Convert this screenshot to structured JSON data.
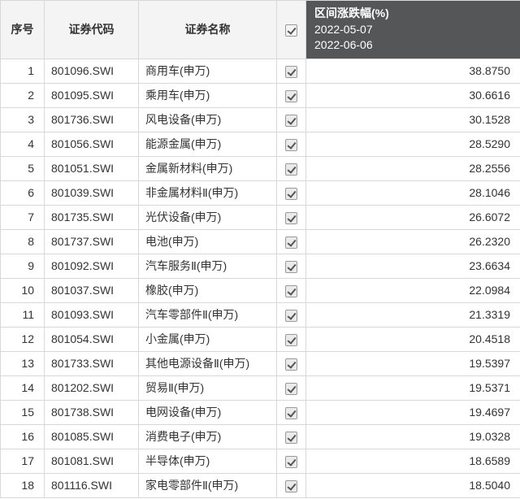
{
  "headers": {
    "index": "序号",
    "code": "证券代码",
    "name": "证券名称",
    "change_title": "区间涨跌幅(%)",
    "date_from": "2022-05-07",
    "date_to": "2022-06-06"
  },
  "rows": [
    {
      "idx": 1,
      "code": "801096.SWI",
      "name": "商用车(申万)",
      "checked": true,
      "val": "38.8750"
    },
    {
      "idx": 2,
      "code": "801095.SWI",
      "name": "乘用车(申万)",
      "checked": true,
      "val": "30.6616"
    },
    {
      "idx": 3,
      "code": "801736.SWI",
      "name": "风电设备(申万)",
      "checked": true,
      "val": "30.1528"
    },
    {
      "idx": 4,
      "code": "801056.SWI",
      "name": "能源金属(申万)",
      "checked": true,
      "val": "28.5290"
    },
    {
      "idx": 5,
      "code": "801051.SWI",
      "name": "金属新材料(申万)",
      "checked": true,
      "val": "28.2556"
    },
    {
      "idx": 6,
      "code": "801039.SWI",
      "name": "非金属材料Ⅱ(申万)",
      "checked": true,
      "val": "28.1046"
    },
    {
      "idx": 7,
      "code": "801735.SWI",
      "name": "光伏设备(申万)",
      "checked": true,
      "val": "26.6072"
    },
    {
      "idx": 8,
      "code": "801737.SWI",
      "name": "电池(申万)",
      "checked": true,
      "val": "26.2320"
    },
    {
      "idx": 9,
      "code": "801092.SWI",
      "name": "汽车服务Ⅱ(申万)",
      "checked": true,
      "val": "23.6634"
    },
    {
      "idx": 10,
      "code": "801037.SWI",
      "name": "橡胶(申万)",
      "checked": true,
      "val": "22.0984"
    },
    {
      "idx": 11,
      "code": "801093.SWI",
      "name": "汽车零部件Ⅱ(申万)",
      "checked": true,
      "val": "21.3319"
    },
    {
      "idx": 12,
      "code": "801054.SWI",
      "name": "小金属(申万)",
      "checked": true,
      "val": "20.4518"
    },
    {
      "idx": 13,
      "code": "801733.SWI",
      "name": "其他电源设备Ⅱ(申万)",
      "checked": true,
      "val": "19.5397"
    },
    {
      "idx": 14,
      "code": "801202.SWI",
      "name": "贸易Ⅱ(申万)",
      "checked": true,
      "val": "19.5371"
    },
    {
      "idx": 15,
      "code": "801738.SWI",
      "name": "电网设备(申万)",
      "checked": true,
      "val": "19.4697"
    },
    {
      "idx": 16,
      "code": "801085.SWI",
      "name": "消费电子(申万)",
      "checked": true,
      "val": "19.0328"
    },
    {
      "idx": 17,
      "code": "801081.SWI",
      "name": "半导体(申万)",
      "checked": true,
      "val": "18.6589"
    },
    {
      "idx": 18,
      "code": "801116.SWI",
      "name": "家电零部件Ⅱ(申万)",
      "checked": true,
      "val": "18.5040"
    }
  ]
}
